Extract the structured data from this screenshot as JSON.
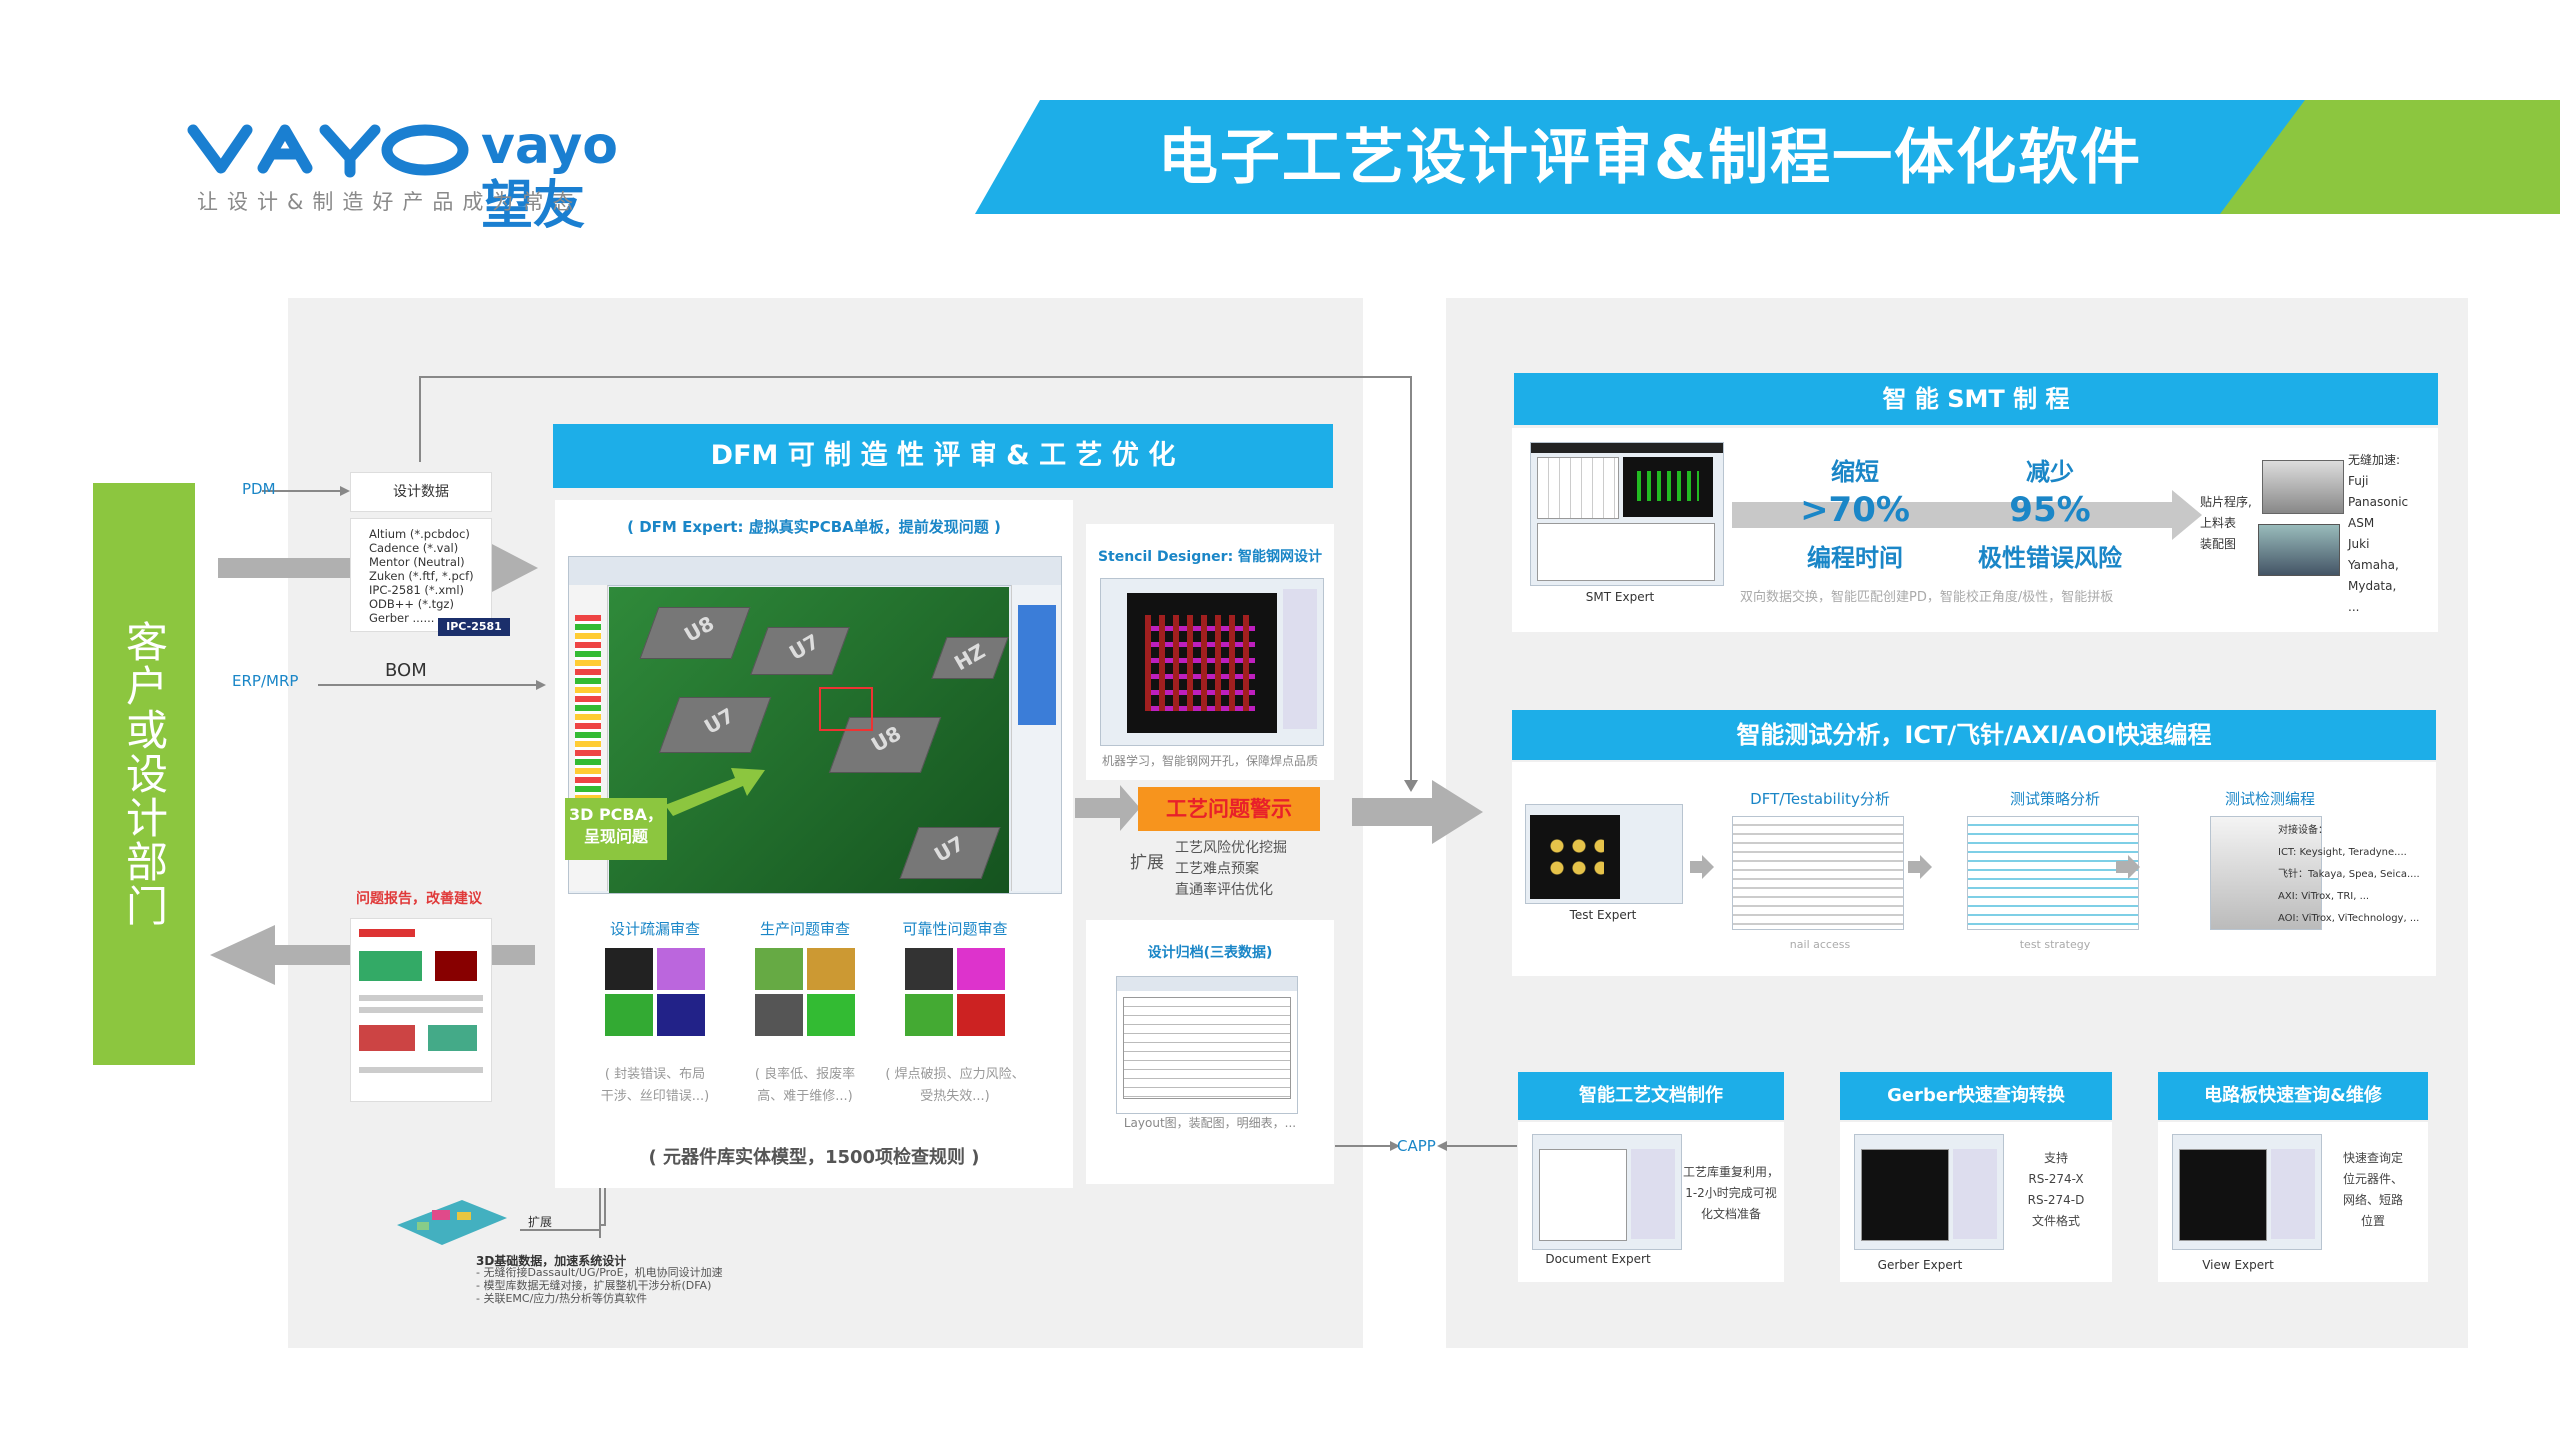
{
  "header": {
    "logo_text": "vayo望友",
    "slogan": "让设计&制造好产品成为常态",
    "title": "电子工艺设计评审&制程一体化软件"
  },
  "colors": {
    "blue": "#1daee8",
    "green": "#8cc63f",
    "orange": "#f7941d",
    "grey_arrow": "#b0b0b0",
    "panel": "#f0f0f0"
  },
  "left": {
    "customer": "客户或设计部门",
    "pdm": "PDM",
    "erp": "ERP/MRP",
    "bom": "BOM",
    "design_data_title": "设计数据",
    "design_data_items": [
      "Altium (*.pcbdoc)",
      "Cadence (*.val)",
      "Mentor (Neutral)",
      "Zuken (*.ftf, *.pcf)",
      "IPC-2581 (*.xml)",
      "ODB++ (*.tgz)",
      "Gerber ......"
    ],
    "ipc_badge": "IPC-2581",
    "report_title": "问题报告，改善建议",
    "ext_3d_label": "扩展",
    "ext_3d_title": "3D基础数据，加速系统设计",
    "ext_3d_items": [
      "- 无缝衔接Dassault/UG/ProE，机电协同设计加速",
      "- 模型库数据无缝对接，扩展整机干涉分析(DFA)",
      "- 关联EMC/应力/热分析等仿真软件"
    ]
  },
  "dfm": {
    "title": "DFM 可 制 造 性 评 审 & 工 艺 优 化",
    "subtitle": "( DFM Expert: 虚拟真实PCBA单板，提前发现问题 )",
    "callout": "3D PCBA，\n呈现问题",
    "chip_labels": [
      "U8",
      "U7",
      "U7",
      "U8",
      "U7",
      "HZ"
    ],
    "checks": [
      {
        "title": "设计疏漏审查",
        "desc": "( 封装错误、布局\n干涉、丝印错误...)"
      },
      {
        "title": "生产问题审查",
        "desc": "( 良率低、报废率\n高、难于维修...)"
      },
      {
        "title": "可靠性问题审查",
        "desc": "( 焊点破损、应力风险、\n受热失效...)"
      }
    ],
    "footer": "( 元器件库实体模型，1500项检查规则 )",
    "stencil_title": "Stencil Designer: 智能钢网设计",
    "stencil_desc": "机器学习，智能钢网开孔，保障焊点品质",
    "archive_title": "设计归档(三表数据)",
    "archive_desc": "Layout图，装配图，明细表，...",
    "alert": "工艺问题警示",
    "ext_label": "扩展",
    "ext_items": [
      "工艺风险优化挖掘",
      "工艺难点预案",
      "直通率评估优化"
    ],
    "capp": "CAPP"
  },
  "smt": {
    "title": "智 能 SMT 制 程",
    "caption": "SMT Expert",
    "m1_top": "缩短",
    "m1_val": ">70%",
    "m1_bot": "编程时间",
    "m2_top": "减少",
    "m2_val": "95%",
    "m2_bot": "极性错误风险",
    "desc": "双向数据交换，智能匹配创建PD，智能校正角度/极性，智能拼板",
    "machine_labels": [
      "贴片程序,",
      "上料表",
      "装配图"
    ],
    "brands_title": "无缝加速:",
    "brands": [
      "Fuji",
      "Panasonic",
      "ASM",
      "Juki",
      "Yamaha,",
      "Mydata,",
      "..."
    ]
  },
  "test": {
    "title": "智能测试分析，ICT/飞针/AXI/AOI快速编程",
    "caption": "Test Expert",
    "steps": [
      {
        "title": "DFT/Testability分析",
        "caption": "nail access"
      },
      {
        "title": "测试策略分析",
        "caption": "test strategy"
      },
      {
        "title": "测试检测编程",
        "caption": ""
      }
    ],
    "devices_title": "对接设备：",
    "devices": [
      "ICT: Keysight, Teradyne....",
      "飞针：Takaya, Spea, Seica....",
      "AXI: ViTrox, TRI, ...",
      "AOI: ViTrox, ViTechnology, ..."
    ]
  },
  "bottom": [
    {
      "title": "智能工艺文档制作",
      "caption": "Document Expert",
      "desc": "工艺库重复利用，\n1-2小时完成可视\n化文档准备"
    },
    {
      "title": "Gerber快速查询转换",
      "caption": "Gerber Expert",
      "desc": "支持\nRS-274-X\nRS-274-D\n文件格式"
    },
    {
      "title": "电路板快速查询&维修",
      "caption": "View Expert",
      "desc": "快速查询定\n位元器件、\n网络、短路\n位置"
    }
  ]
}
